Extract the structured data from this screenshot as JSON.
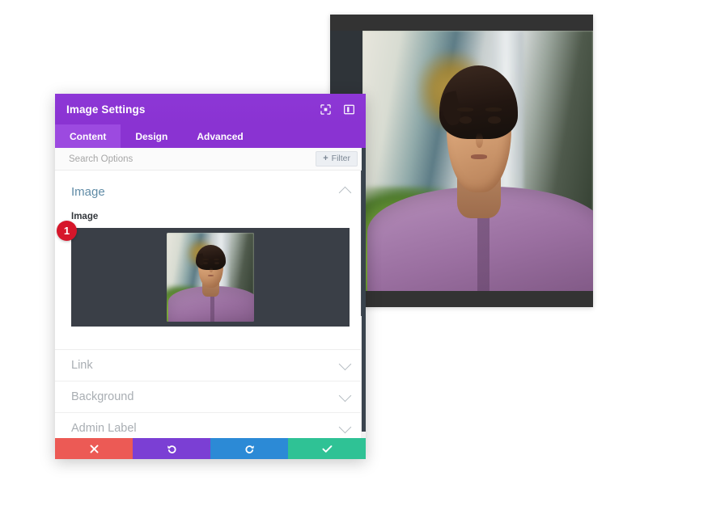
{
  "modal": {
    "title": "Image Settings",
    "header_icons": [
      {
        "name": "expand-icon",
        "label": "Expand"
      },
      {
        "name": "layout-toggle-icon",
        "label": "Layout"
      }
    ],
    "tabs": [
      {
        "label": "Content",
        "active": true
      },
      {
        "label": "Design",
        "active": false
      },
      {
        "label": "Advanced",
        "active": false
      }
    ],
    "search": {
      "placeholder": "Search Options",
      "value": ""
    },
    "filter_button": {
      "label": "Filter",
      "plus": "+"
    },
    "sections": [
      {
        "title": "Image",
        "expanded": true,
        "field_label": "Image",
        "badge": "1"
      },
      {
        "title": "Link",
        "expanded": false
      },
      {
        "title": "Background",
        "expanded": false
      },
      {
        "title": "Admin Label",
        "expanded": false
      }
    ],
    "footer_buttons": [
      {
        "name": "cancel-button",
        "icon": "close-icon",
        "glyph": "✖"
      },
      {
        "name": "undo-button",
        "icon": "undo-icon",
        "glyph": "↺"
      },
      {
        "name": "redo-button",
        "icon": "redo-icon",
        "glyph": "↻"
      },
      {
        "name": "save-button",
        "icon": "check-icon",
        "glyph": "✔"
      }
    ]
  },
  "colors": {
    "header_purple": "#8a33d2",
    "tab_active": "#9c4ae0",
    "section_title": "#5f8ba6",
    "badge_red": "#d6162a",
    "upload_bg": "#3a3f47",
    "cancel": "#ec5a55",
    "undo": "#7b3fd4",
    "redo": "#2c8ad6",
    "save": "#2fc295"
  },
  "preview": {
    "name": "page-image-module-preview",
    "alt": "Portrait photo of a man in a purple shirt outdoors"
  }
}
